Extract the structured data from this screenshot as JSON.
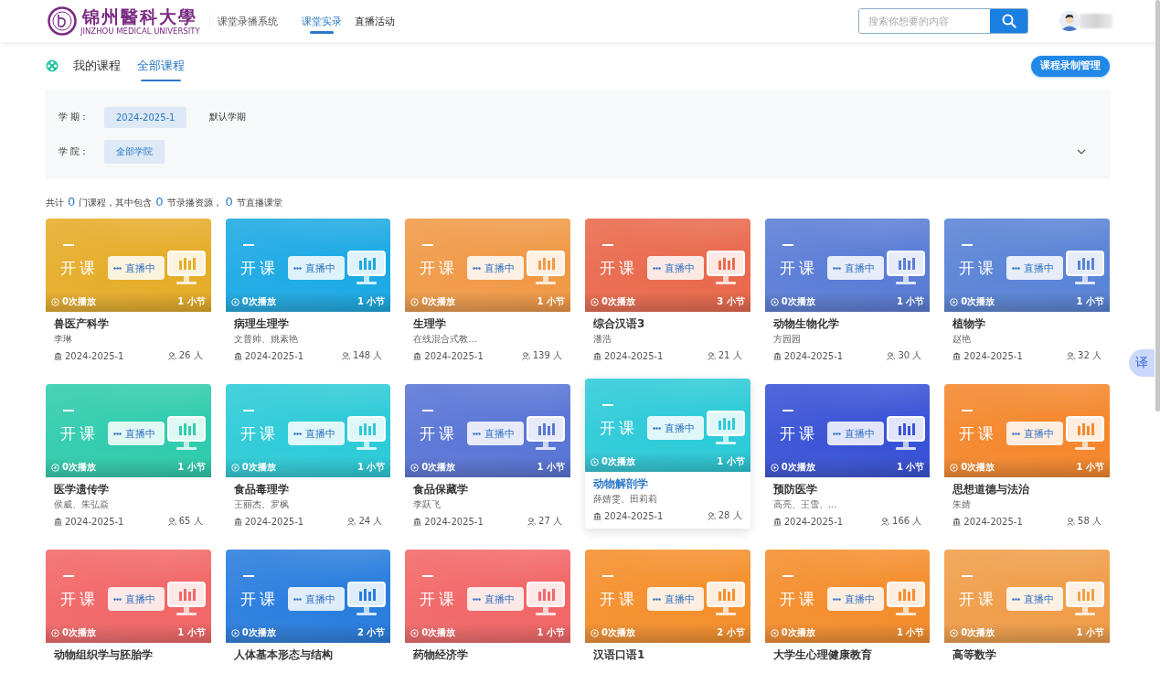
{
  "header": {
    "logo": {
      "name": "锦州醫科大學",
      "subtitle": "JINZHOU MEDICAL UNIVERSITY"
    },
    "system": "课堂录播系统",
    "nav": [
      {
        "label": "课堂实录",
        "selected": true
      },
      {
        "label": "直播活动",
        "selected": false
      }
    ],
    "search": {
      "placeholder": "搜索你想要的内容"
    }
  },
  "tabs": [
    {
      "label": "我的课程",
      "selected": false
    },
    {
      "label": "全部课程",
      "selected": true
    }
  ],
  "manage_button": "课程录制管理",
  "filters": [
    {
      "label": "学 期：",
      "options": [
        {
          "label": "2024-2025-1",
          "selected": true
        },
        {
          "label": "默认学期",
          "selected": false
        }
      ]
    },
    {
      "label": "学 院：",
      "options": [
        {
          "label": "全部学院",
          "selected": true
        }
      ],
      "expandable": true
    }
  ],
  "summary": [
    {
      "kind": "text",
      "text": "共计"
    },
    {
      "kind": "number",
      "text": "0"
    },
    {
      "kind": "text",
      "text": "门课程，其中包含"
    },
    {
      "kind": "number",
      "text": "0"
    },
    {
      "kind": "text",
      "text": "节录播资源，"
    },
    {
      "kind": "number",
      "text": "0"
    },
    {
      "kind": "text",
      "text": "节直播课堂"
    }
  ],
  "courses": [
    {
      "title": "兽医产科学",
      "teacher": "李琳",
      "term": "2024-2025-1",
      "students": "26 人",
      "plays": "0次播放",
      "lessons": "1 小节",
      "banner": "开课",
      "live": "直播中",
      "color": "#e6ad2a",
      "selected": false
    },
    {
      "title": "病理生理学",
      "teacher": "文普帅、姚素艳",
      "term": "2024-2025-1",
      "students": "148 人",
      "plays": "0次播放",
      "lessons": "1 小节",
      "banner": "开课",
      "live": "直播中",
      "color": "#1eaae4",
      "selected": false
    },
    {
      "title": "生理学",
      "teacher": "在线混合式教...",
      "term": "2024-2025-1",
      "students": "139 人",
      "plays": "0次播放",
      "lessons": "1 小节",
      "banner": "开课",
      "live": "直播中",
      "color": "#f09a48",
      "selected": false
    },
    {
      "title": "综合汉语3",
      "teacher": "潘浩",
      "term": "2024-2025-1",
      "students": "21 人",
      "plays": "0次播放",
      "lessons": "3 小节",
      "banner": "开课",
      "live": "直播中",
      "color": "#e96a4e",
      "selected": false
    },
    {
      "title": "动物生物化学",
      "teacher": "方园园",
      "term": "2024-2025-1",
      "students": "30 人",
      "plays": "0次播放",
      "lessons": "1 小节",
      "banner": "开课",
      "live": "直播中",
      "color": "#5b7dd6",
      "selected": false
    },
    {
      "title": "植物学",
      "teacher": "赵艳",
      "term": "2024-2025-1",
      "students": "32 人",
      "plays": "0次播放",
      "lessons": "1 小节",
      "banner": "开课",
      "live": "直播中",
      "color": "#5a84d6",
      "selected": false
    },
    {
      "title": "医学遗传学",
      "teacher": "侯威、朱弘焱",
      "term": "2024-2025-1",
      "students": "65 人",
      "plays": "0次播放",
      "lessons": "1 小节",
      "banner": "开课",
      "live": "直播中",
      "color": "#31ccae",
      "selected": false
    },
    {
      "title": "食品毒理学",
      "teacher": "王丽杰、罗枫",
      "term": "2024-2025-1",
      "students": "24 人",
      "plays": "0次播放",
      "lessons": "1 小节",
      "banner": "开课",
      "live": "直播中",
      "color": "#2ecbd8",
      "selected": false
    },
    {
      "title": "食品保藏学",
      "teacher": "李跃飞",
      "term": "2024-2025-1",
      "students": "27 人",
      "plays": "0次播放",
      "lessons": "1 小节",
      "banner": "开课",
      "live": "直播中",
      "color": "#5a76d6",
      "selected": false
    },
    {
      "title": "动物解剖学",
      "teacher": "薛婧雯、田莉莉",
      "term": "2024-2025-1",
      "students": "28 人",
      "plays": "0次播放",
      "lessons": "1 小节",
      "banner": "开课",
      "live": "直播中",
      "color": "#2ecbd8",
      "selected": true
    },
    {
      "title": "预防医学",
      "teacher": "高亮、王雪、...",
      "term": "2024-2025-1",
      "students": "166 人",
      "plays": "0次播放",
      "lessons": "1 小节",
      "banner": "开课",
      "live": "直播中",
      "color": "#3a53d6",
      "selected": false
    },
    {
      "title": "思想道德与法治",
      "teacher": "朱婧",
      "term": "2024-2025-1",
      "students": "58 人",
      "plays": "0次播放",
      "lessons": "1 小节",
      "banner": "开课",
      "live": "直播中",
      "color": "#f5882e",
      "selected": false
    },
    {
      "title": "动物组织学与胚胎学",
      "plays": "0次播放",
      "lessons": "1 小节",
      "banner": "开课",
      "live": "直播中",
      "color": "#f26868",
      "selected": false
    },
    {
      "title": "人体基本形态与结构",
      "plays": "0次播放",
      "lessons": "2 小节",
      "banner": "开课",
      "live": "直播中",
      "color": "#2a7ede",
      "selected": false
    },
    {
      "title": "药物经济学",
      "plays": "0次播放",
      "lessons": "1 小节",
      "banner": "开课",
      "live": "直播中",
      "color": "#f26868",
      "selected": false
    },
    {
      "title": "汉语口语1",
      "plays": "0次播放",
      "lessons": "2 小节",
      "banner": "开课",
      "live": "直播中",
      "color": "#f5902e",
      "selected": false
    },
    {
      "title": "大学生心理健康教育",
      "plays": "0次播放",
      "lessons": "1 小节",
      "banner": "开课",
      "live": "直播中",
      "color": "#f58e2e",
      "selected": false
    },
    {
      "title": "高等数学",
      "plays": "0次播放",
      "lessons": "1 小节",
      "banner": "开课",
      "live": "直播中",
      "color": "#f09e4a",
      "selected": false
    }
  ],
  "translate_button": "译"
}
